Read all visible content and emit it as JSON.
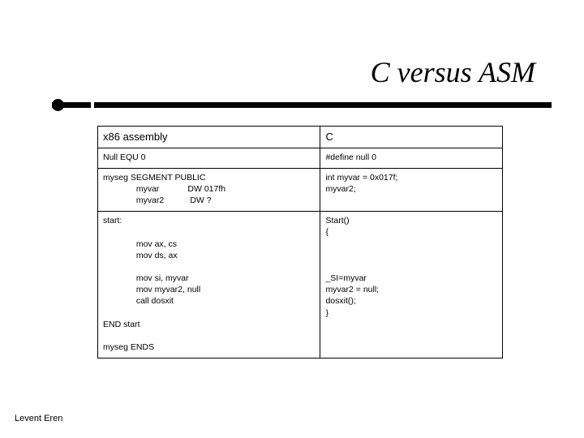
{
  "title": "C versus ASM",
  "table": {
    "headers": {
      "asm": "x86 assembly",
      "c": "C"
    },
    "row1": {
      "asm": "Null EQU 0",
      "c": "#define null 0"
    },
    "row2": {
      "asm": "myseg SEGMENT PUBLIC\n              myvar            DW 017fh\n              myvar2           DW ?",
      "c": "int myvar = 0x017f;\nmyvar2;"
    },
    "row3": {
      "asm": "start:\n\n              mov ax, cs\n              mov ds, ax\n\n              mov si, myvar\n              mov myvar2, null\n              call dosxit\n\nEND start\n\nmyseg ENDS",
      "c": "Start()\n{\n\n\n\n_SI=myvar\nmyvar2 = null;\ndosxit();\n}"
    }
  },
  "footer": "Levent Eren"
}
